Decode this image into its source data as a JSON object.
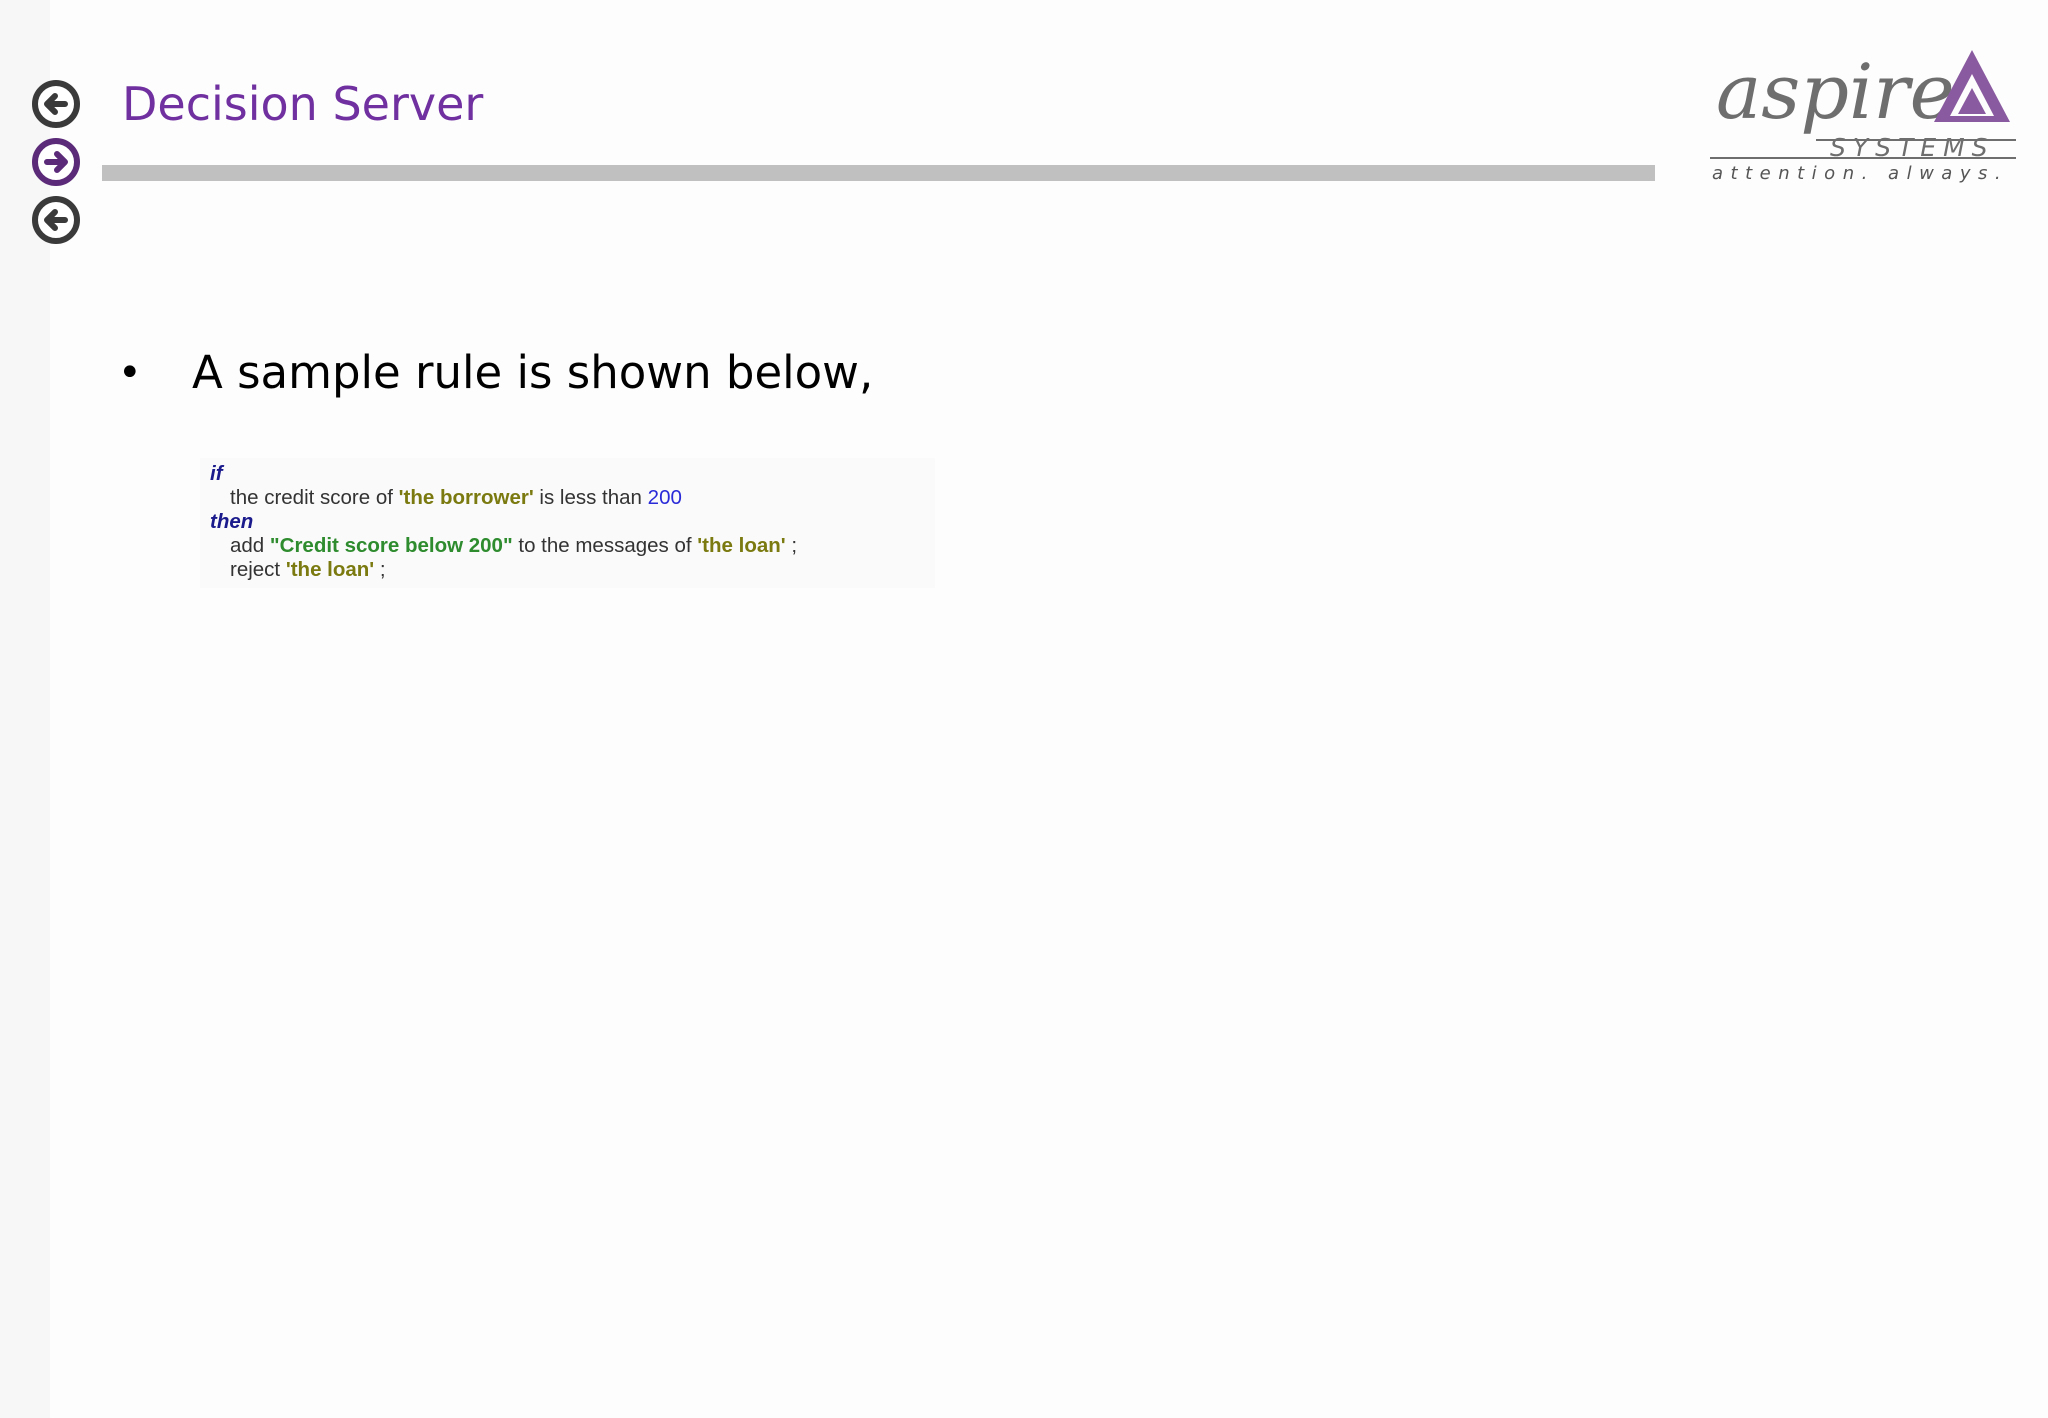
{
  "slide": {
    "title": "Decision Server",
    "bullet": "A sample rule is shown below,"
  },
  "navigation": {
    "back_top_icon": "arrow-left-circle-icon",
    "forward_icon": "arrow-right-circle-icon",
    "back_bottom_icon": "arrow-left-circle-icon"
  },
  "logo": {
    "word": "aspire",
    "company": "SYSTEMS",
    "tagline": "attention. always."
  },
  "rule": {
    "if_keyword": "if",
    "cond_1": "the credit score of",
    "cond_ref": "'the borrower'",
    "cond_2": "is less than",
    "cond_value": "200",
    "then_keyword": "then",
    "add_word": "add",
    "add_string": "\"Credit score below 200\"",
    "add_mid": "to the messages of",
    "add_ref": "'the loan'",
    "add_end": ";",
    "reject_word": "reject",
    "reject_ref": "'the loan'",
    "reject_end": ";"
  },
  "colors": {
    "title": "#7030a0",
    "rule_bar": "#c0c0c0",
    "keyword": "#1a1a8c",
    "reference": "#7a7a10",
    "string": "#2e8b2e",
    "number": "#2a2ad8",
    "logo_purple": "#8a5aa0"
  }
}
